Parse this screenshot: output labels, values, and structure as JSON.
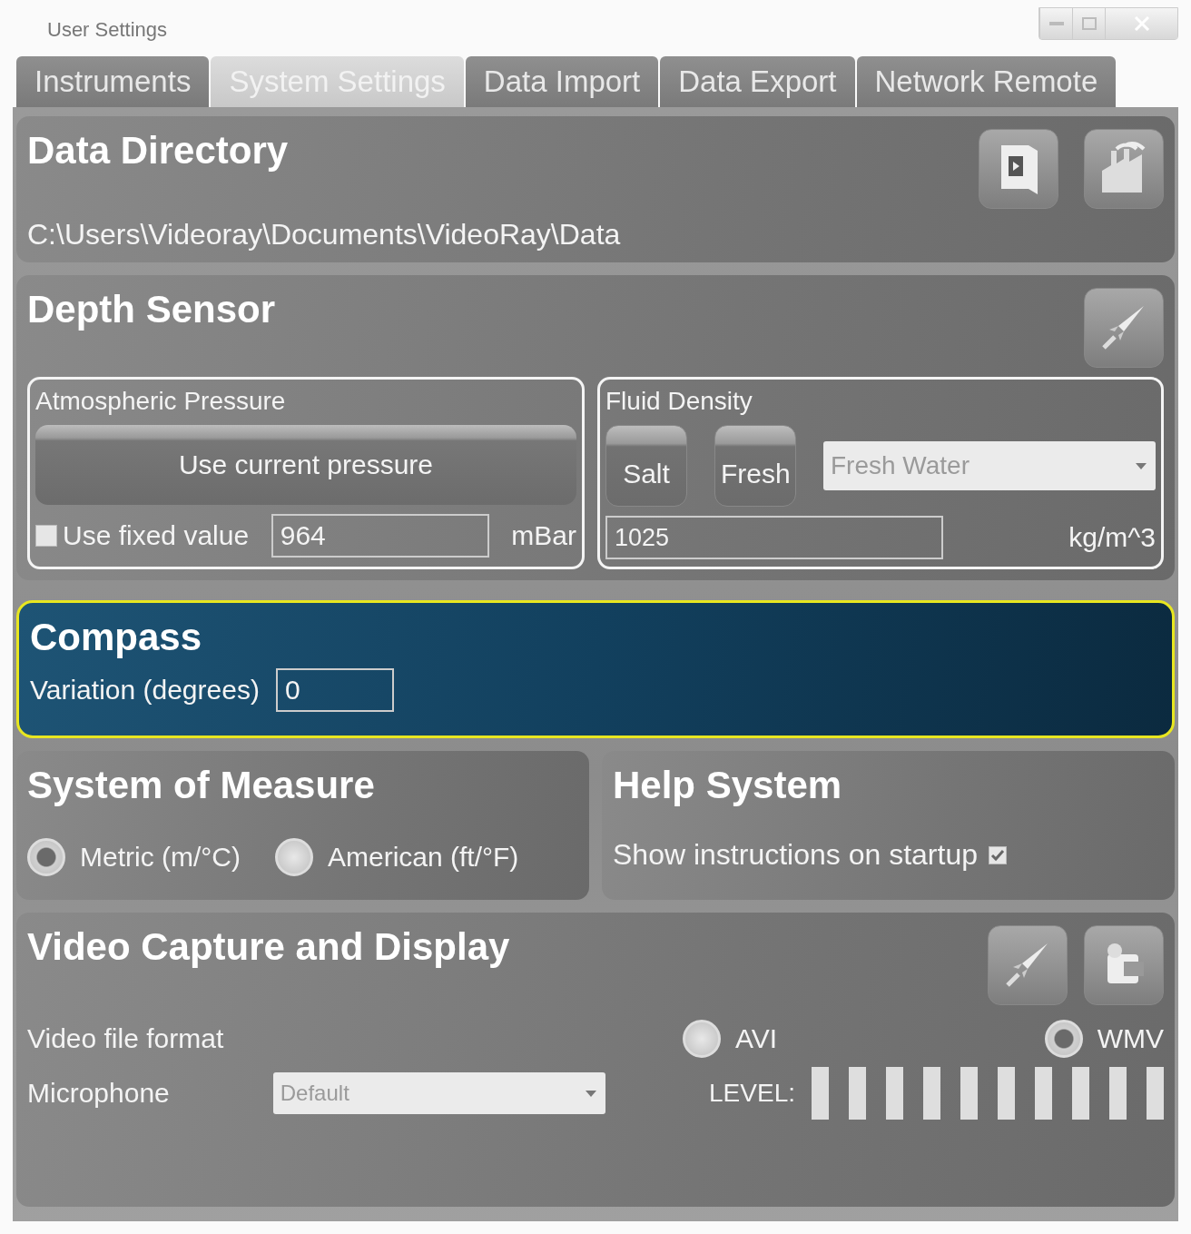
{
  "window": {
    "title": "User Settings"
  },
  "tabs": [
    {
      "label": "Instruments",
      "selected": false
    },
    {
      "label": "System Settings",
      "selected": true
    },
    {
      "label": "Data Import",
      "selected": false
    },
    {
      "label": "Data Export",
      "selected": false
    },
    {
      "label": "Network Remote",
      "selected": false
    }
  ],
  "data_directory": {
    "title": "Data Directory",
    "path": "C:\\Users\\Videoray\\Documents\\VideoRay\\Data"
  },
  "depth_sensor": {
    "title": "Depth Sensor",
    "atmospheric": {
      "title": "Atmospheric Pressure",
      "button": "Use current pressure",
      "use_fixed": {
        "label": "Use fixed value",
        "checked": false
      },
      "value": "964",
      "unit": "mBar"
    },
    "fluid": {
      "title": "Fluid Density",
      "buttons": [
        "Salt",
        "Fresh"
      ],
      "dropdown": "Fresh Water",
      "value": "1025",
      "unit": "kg/m^3"
    }
  },
  "compass": {
    "title": "Compass",
    "highlighted": true,
    "label": "Variation (degrees)",
    "value": "0"
  },
  "system_of_measure": {
    "title": "System of Measure",
    "options": [
      {
        "label": "Metric (m/°C)",
        "selected": true
      },
      {
        "label": "American (ft/°F)",
        "selected": false
      }
    ]
  },
  "help_system": {
    "title": "Help System",
    "option": {
      "label": "Show instructions on startup",
      "checked": true
    }
  },
  "video": {
    "title": "Video Capture and Display",
    "format_label": "Video file format",
    "formats": [
      {
        "label": "AVI",
        "selected": false
      },
      {
        "label": "WMV",
        "selected": true
      }
    ],
    "microphone_label": "Microphone",
    "microphone": "Default",
    "level_label": "LEVEL:"
  }
}
